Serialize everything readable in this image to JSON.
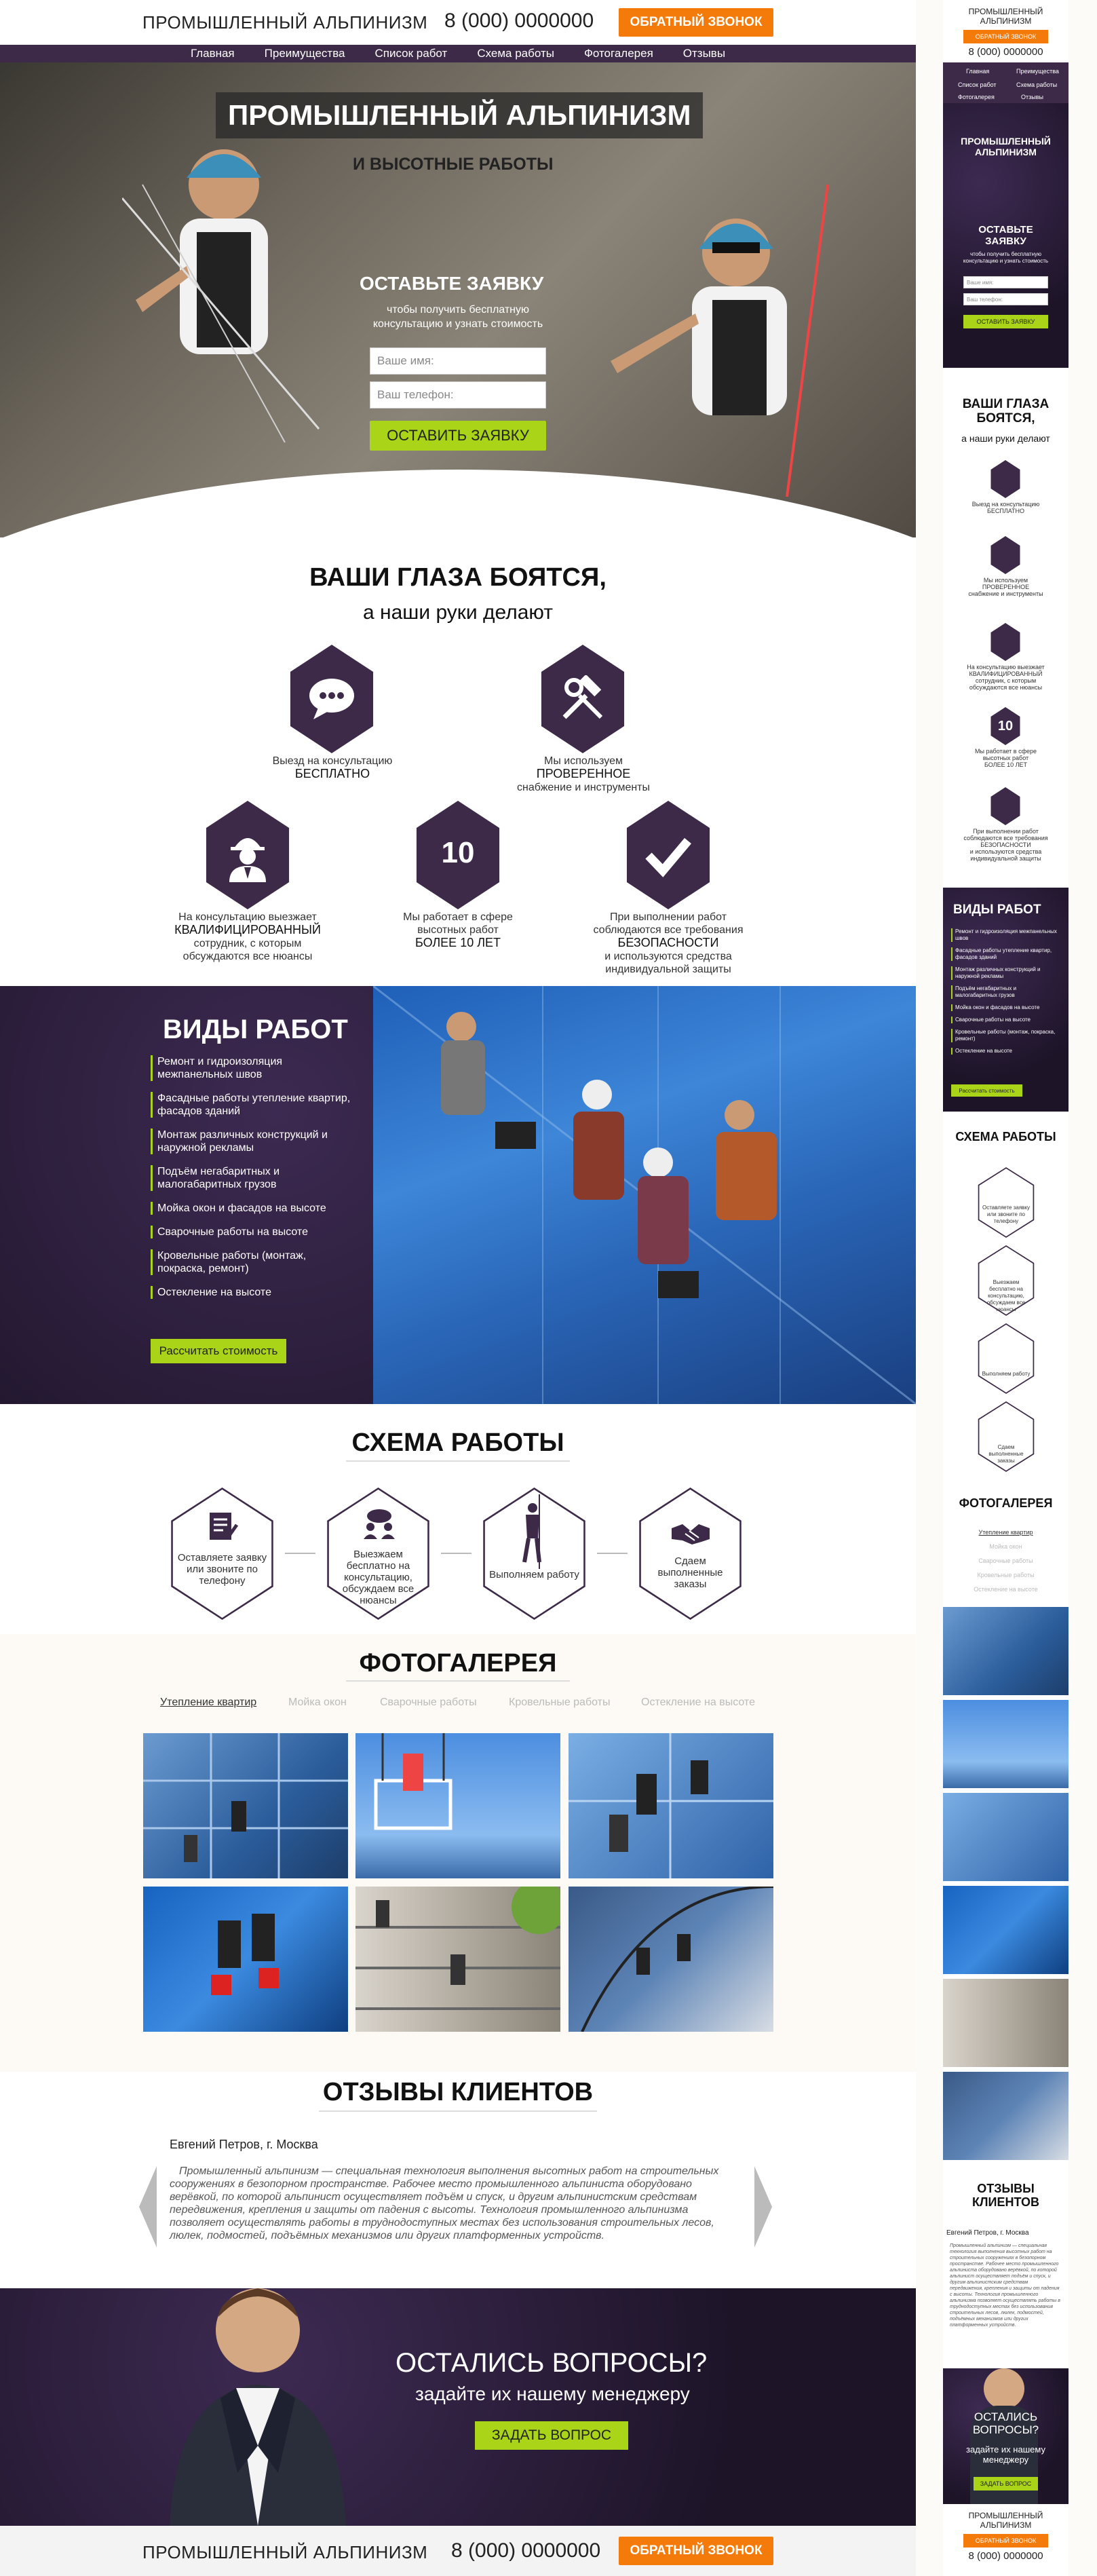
{
  "header": {
    "logo": "ПРОМЫШЛЕННЫЙ АЛЬПИНИЗМ",
    "phone": "8 (000) 0000000",
    "callback": "ОБРАТНЫЙ ЗВОНОК"
  },
  "nav": [
    "Главная",
    "Преимущества",
    "Список работ",
    "Схема работы",
    "Фотогалерея",
    "Отзывы"
  ],
  "hero": {
    "title": "ПРОМЫШЛЕННЫЙ АЛЬПИНИЗМ",
    "subtitle": "И ВЫСОТНЫЕ РАБОТЫ",
    "form_title": "ОСТАВЬТЕ ЗАЯВКУ",
    "form_sub1": "чтобы получить бесплатную",
    "form_sub2": "консультацию и узнать стоимость",
    "name_placeholder": "Ваше имя:",
    "phone_placeholder": "Ваш телефон:",
    "submit": "ОСТАВИТЬ ЗАЯВКУ"
  },
  "advantages": {
    "title": "ВАШИ ГЛАЗА БОЯТСЯ,",
    "subtitle": "а наши руки делают",
    "items": [
      {
        "icon": "chat-bubble-icon",
        "line1": "Выезд на консультацию",
        "strong": "БЕСПЛАТНО",
        "line2": "",
        "line3": ""
      },
      {
        "icon": "tools-icon",
        "line1": "Мы используем",
        "strong": "ПРОВЕРЕННОЕ",
        "line2": "снабжение и инструменты",
        "line3": ""
      },
      {
        "icon": "worker-icon",
        "line1": "На консультацию выезжает",
        "strong": "КВАЛИФИЦИРОВАННЫЙ",
        "line2": "сотрудник, с которым",
        "line3": "обсуждаются все нюансы"
      },
      {
        "icon": "ten-icon",
        "number": "10",
        "line1": "Мы работает в сфере",
        "line2": "высотных работ",
        "strong": "БОЛЕЕ 10 ЛЕТ",
        "line3": ""
      },
      {
        "icon": "checkmark-icon",
        "line1": "При выполнении работ",
        "line2": "соблюдаются все требования",
        "strong": "БЕЗОПАСНОСТИ",
        "line3": "и используются средства",
        "line4": "индивидуальной защиты"
      }
    ]
  },
  "services": {
    "title": "ВИДЫ РАБОТ",
    "items": [
      "Ремонт и гидроизоляция межпанельных швов",
      "Фасадные работы утепление квартир, фасадов зданий",
      "Монтаж различных конструкций и наружной рекламы",
      "Подъём негабаритных и малогабаритных грузов",
      "Мойка окон и фасадов на высоте",
      "Сварочные работы на высоте",
      "Кровельные работы (монтаж, покраска, ремонт)",
      "Остекление на высоте"
    ],
    "button": "Рассчитать стоимость"
  },
  "scheme": {
    "title": "СХЕМА РАБОТЫ",
    "steps": [
      {
        "icon": "form-icon",
        "text": "Оставляете заявку или звоните по телефону"
      },
      {
        "icon": "meeting-icon",
        "text": "Выезжаем бесплатно на консультацию, обсуждаем все нюансы"
      },
      {
        "icon": "climber-icon",
        "text": "Выполняем работу"
      },
      {
        "icon": "handshake-icon",
        "text": "Сдаем выполненные заказы"
      }
    ]
  },
  "gallery": {
    "title": "ФОТОГАЛЕРЕЯ",
    "tabs": [
      "Утепление квартир",
      "Мойка окон",
      "Сварочные работы",
      "Кровельные работы",
      "Остекление на высоте"
    ]
  },
  "reviews": {
    "title": "ОТЗЫВЫ КЛИЕНТОВ",
    "author": "Евгений Петров, г. Москва",
    "text": "Промышленный альпинизм — специальная технология выполнения высотных работ на строительных сооружениях в безопорном пространстве. Рабочее место промышленного альпиниста оборудовано верёвкой, по которой альпинист осуществляет подъём и спуск, и другим альпинистским средствам передвижения, крепления и защиты от падения с высоты. Технология промышленного альпинизма позволяет осуществлять работы в труднодоступных местах без использования строительных лесов, люлек, подмостей, подъёмных механизмов или других платформенных устройств."
  },
  "questions": {
    "title": "ОСТАЛИСЬ ВОПРОСЫ?",
    "subtitle": "задайте их нашему менеджеру",
    "button": "ЗАДАТЬ ВОПРОС"
  },
  "mobile": {
    "logo_line1": "ПРОМЫШЛЕННЫЙ",
    "logo_line2": "АЛЬПИНИЗМ",
    "form_title1": "ОСТАВЬТЕ",
    "form_title2": "ЗАЯВКУ",
    "form_sub": "чтобы получить бесплатную консультацию и узнать стоимость",
    "adv_title1": "ВАШИ ГЛАЗА",
    "adv_title2": "БОЯТСЯ,"
  },
  "colors": {
    "purple": "#3c2a48",
    "orange": "#f47a0a",
    "green": "#a9d418"
  }
}
